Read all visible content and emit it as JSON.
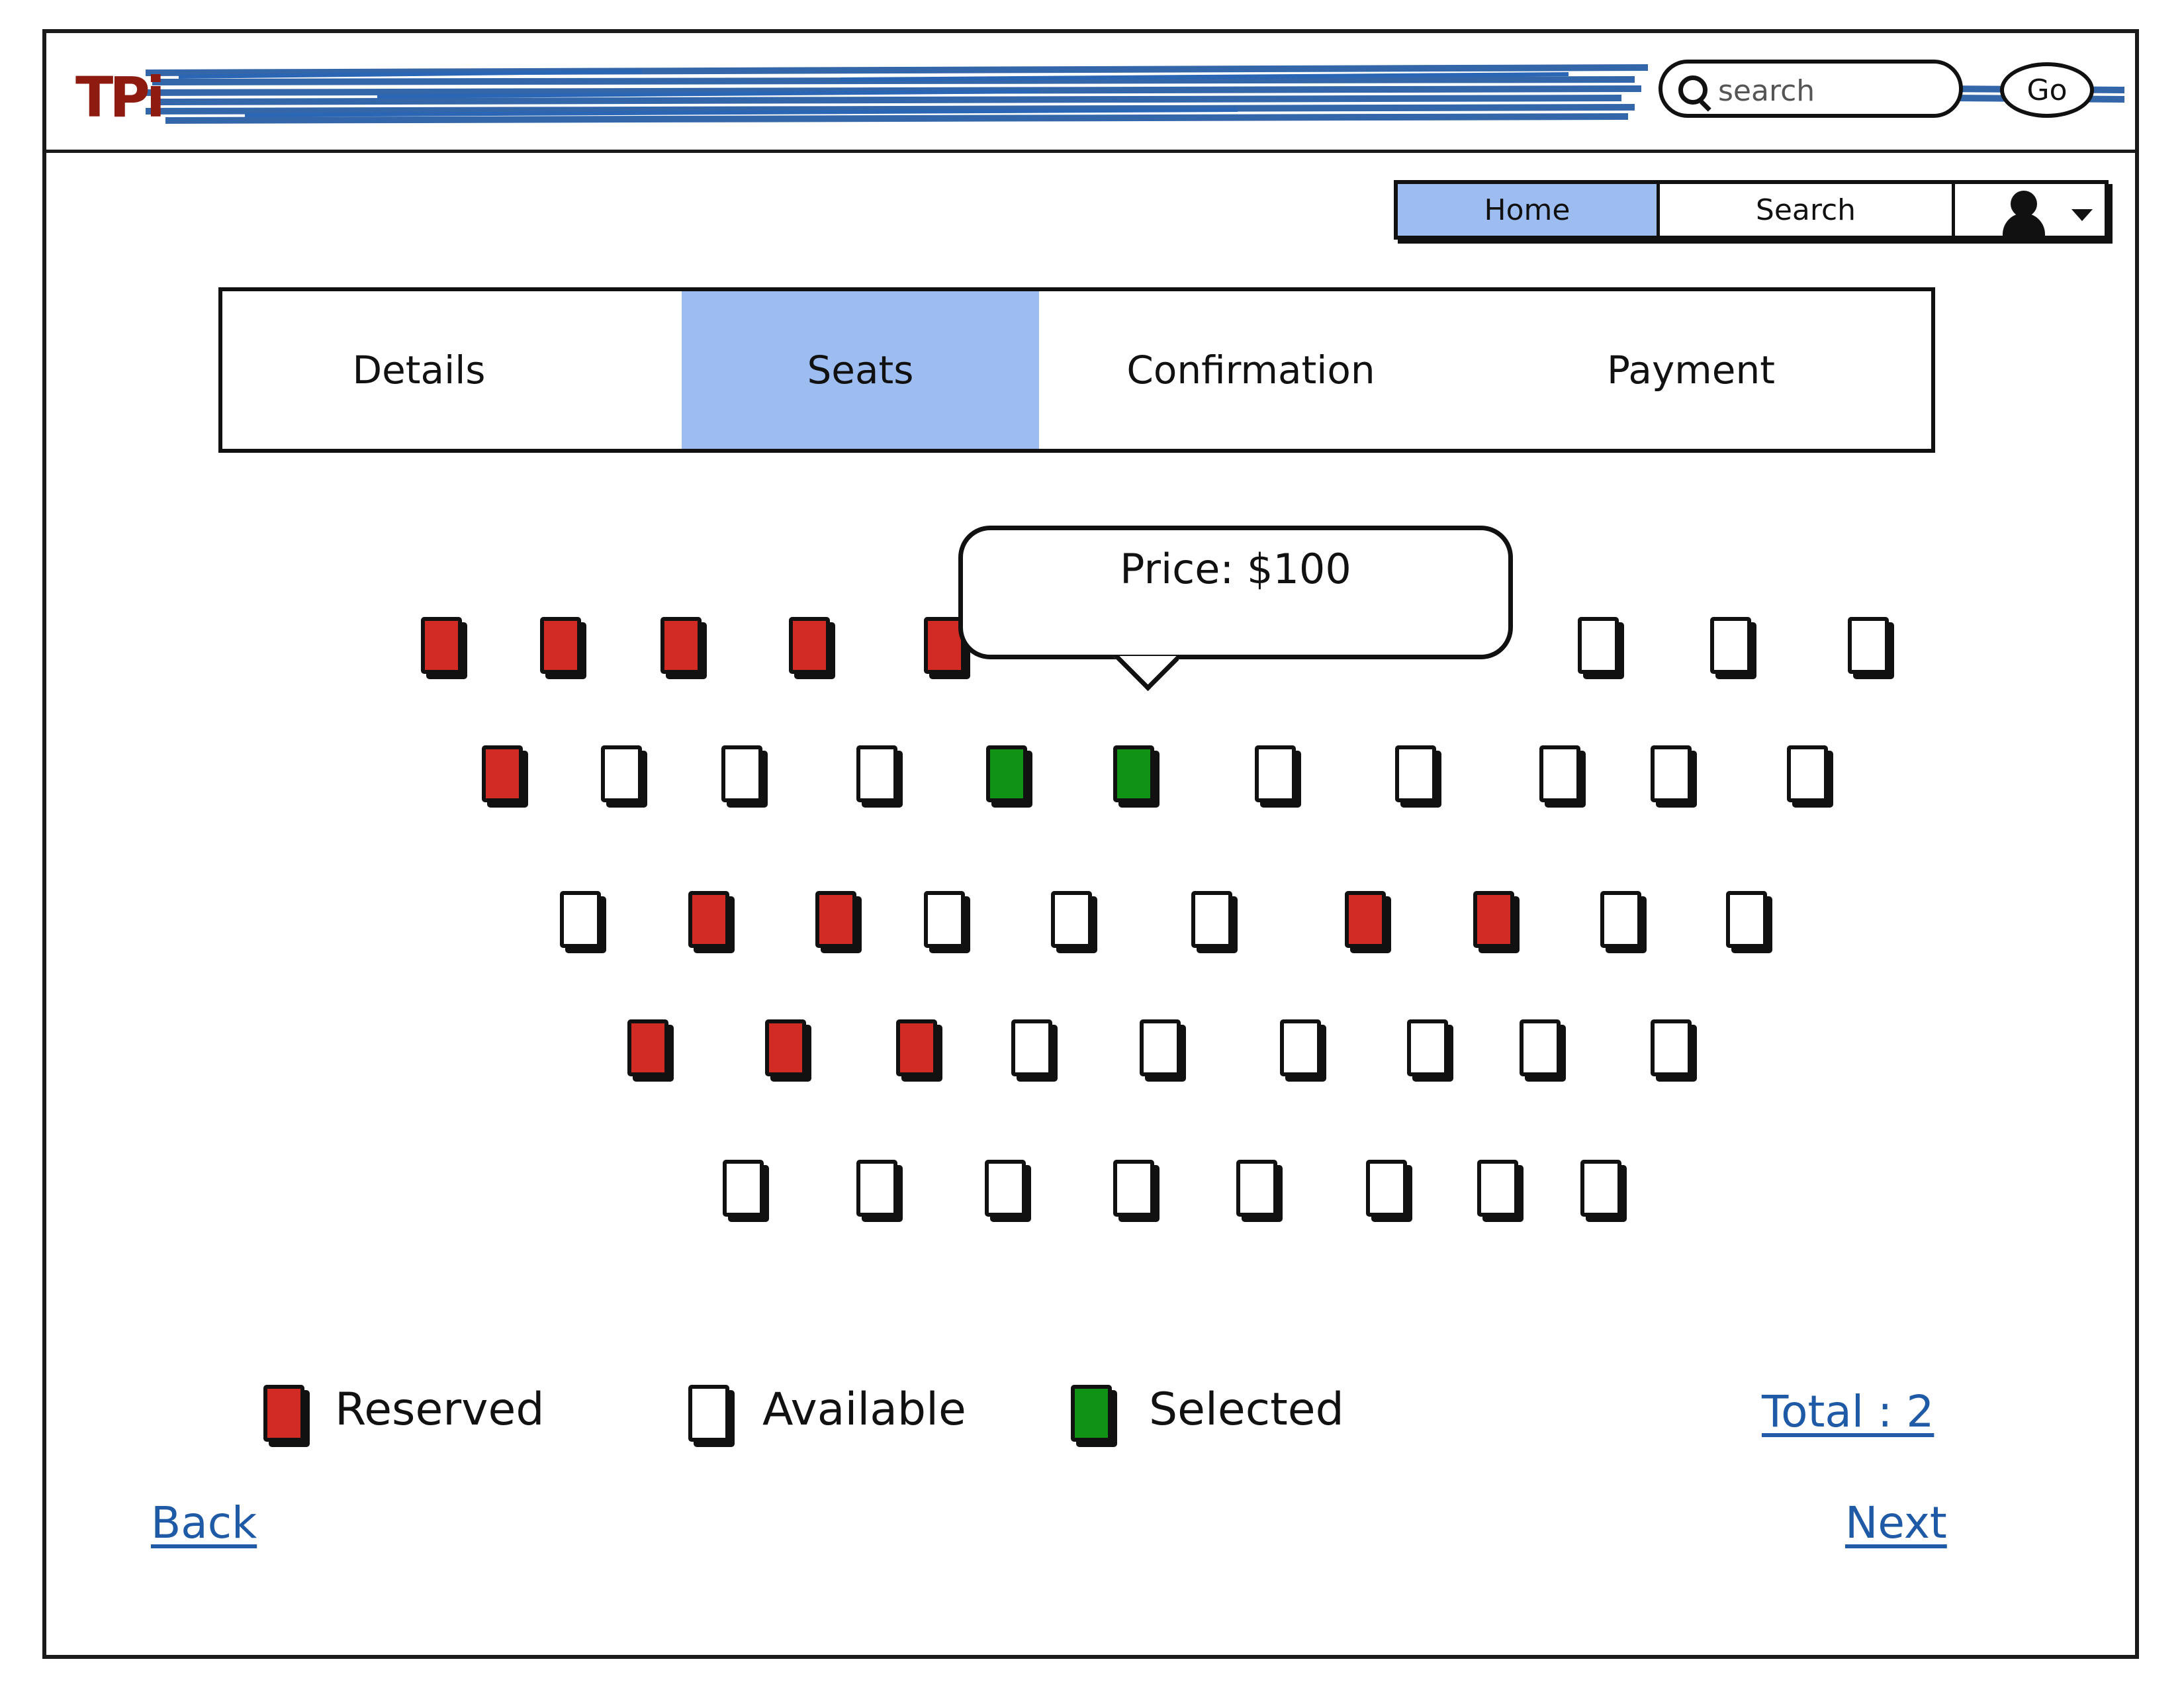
{
  "header": {
    "logo": "TPi",
    "search_placeholder": "search",
    "go_label": "Go"
  },
  "nav": {
    "home": "Home",
    "search": "Search"
  },
  "steps": [
    "Details",
    "Seats",
    "Confirmation",
    "Payment"
  ],
  "active_step": "Seats",
  "tooltip": {
    "text": "Price: $100"
  },
  "seat_rows": [
    [
      "reserved",
      "reserved",
      "reserved",
      "reserved",
      "reserved",
      "available",
      "available",
      "available"
    ],
    [
      "reserved",
      "available",
      "available",
      "available",
      "selected",
      "selected",
      "available",
      "available",
      "available",
      "available",
      "available"
    ],
    [
      "available",
      "reserved",
      "reserved",
      "available",
      "available",
      "available",
      "reserved",
      "reserved",
      "available",
      "available"
    ],
    [
      "reserved",
      "reserved",
      "reserved",
      "available",
      "available",
      "available",
      "available",
      "available",
      "available"
    ],
    [
      "available",
      "available",
      "available",
      "available",
      "available",
      "available",
      "available",
      "available"
    ]
  ],
  "legend": {
    "reserved": "Reserved",
    "available": "Available",
    "selected": "Selected"
  },
  "colors": {
    "reserved": "#d22b24",
    "available": "#ffffff",
    "selected": "#109315",
    "active_tab": "#9dbcf0"
  },
  "total_label": "Total : 2",
  "back_label": "Back",
  "next_label": "Next"
}
